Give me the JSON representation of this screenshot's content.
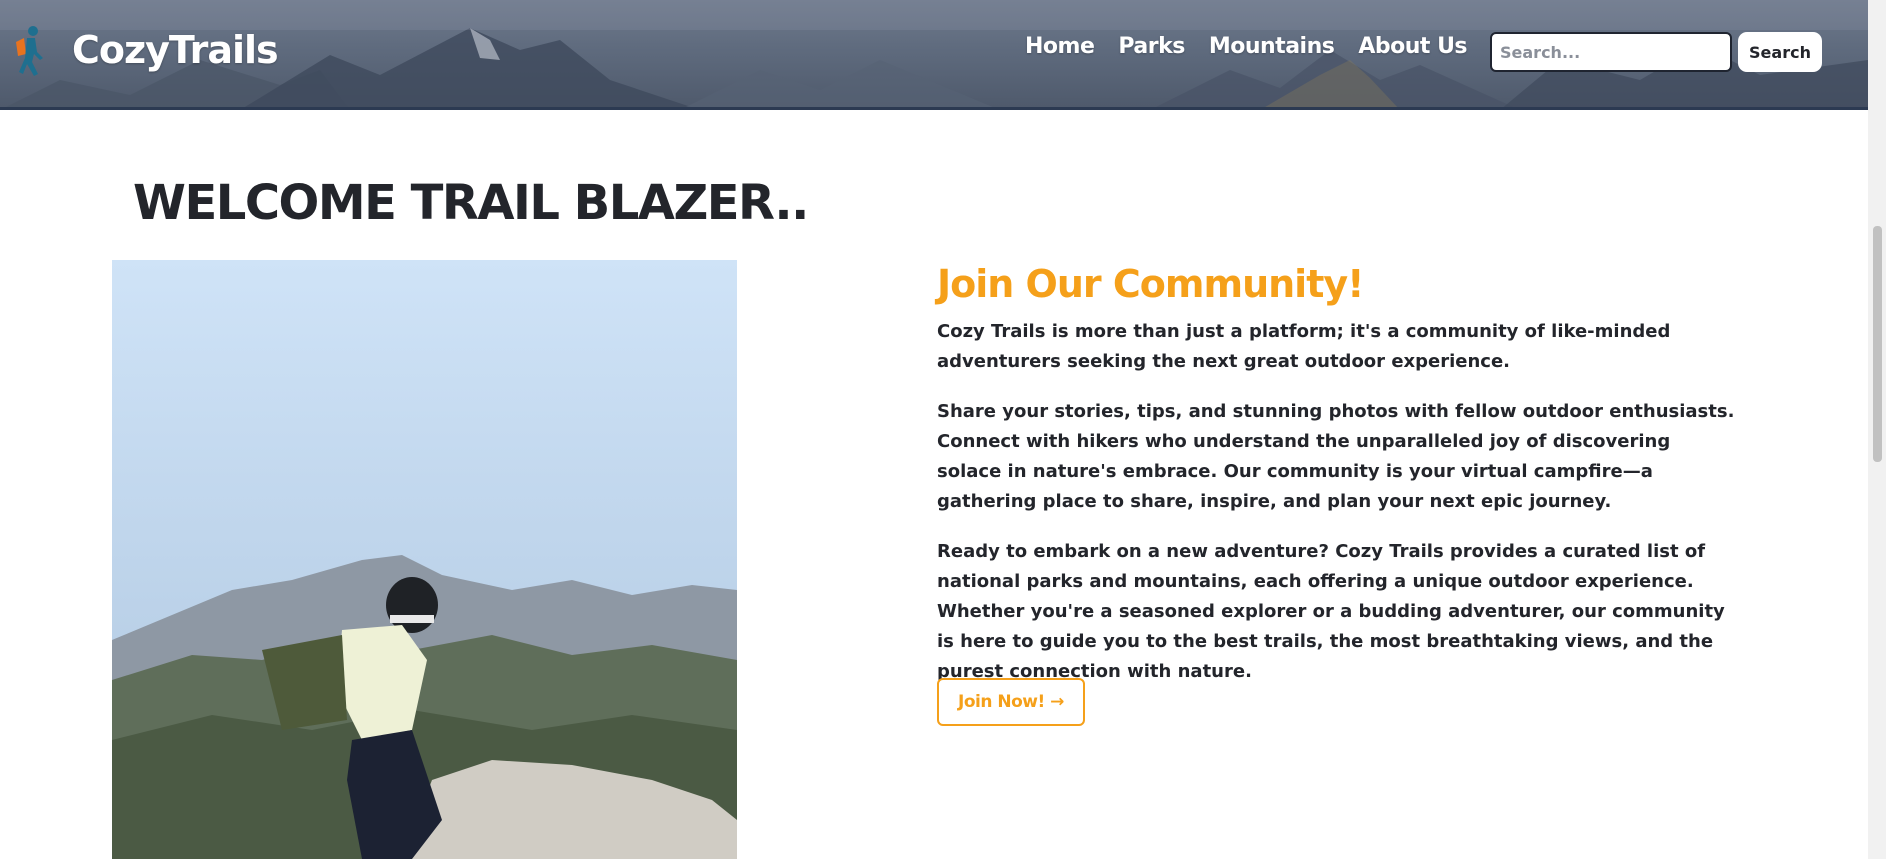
{
  "header": {
    "brand": "CozyTrails",
    "nav": [
      "Home",
      "Parks",
      "Mountains",
      "About Us"
    ],
    "search_placeholder": "Search...",
    "search_button": "Search"
  },
  "main": {
    "welcome_heading": "WELCOME TRAIL BLAZER..",
    "community_title": "Join Our Community!",
    "paragraphs": [
      "Cozy Trails is more than just a platform; it's a community of like-minded adventurers seeking the next great outdoor experience.",
      "Share your stories, tips, and stunning photos with fellow outdoor enthusiasts. Connect with hikers who understand the unparalleled joy of discovering solace in nature's embrace. Our community is your virtual campfire—a gathering place to share, inspire, and plan your next epic journey.",
      "Ready to embark on a new adventure? Cozy Trails provides a curated list of national parks and mountains, each offering a unique outdoor experience. Whether you're a seasoned explorer or a budding adventurer, our community is here to guide you to the best trails, the most breathtaking views, and the purest connection with nature."
    ],
    "join_button": "Join Now! →"
  },
  "colors": {
    "accent": "#f5a01a",
    "text": "#23252b",
    "header_border": "#2c3a52"
  },
  "icons": [
    "hiker-logo-icon"
  ]
}
